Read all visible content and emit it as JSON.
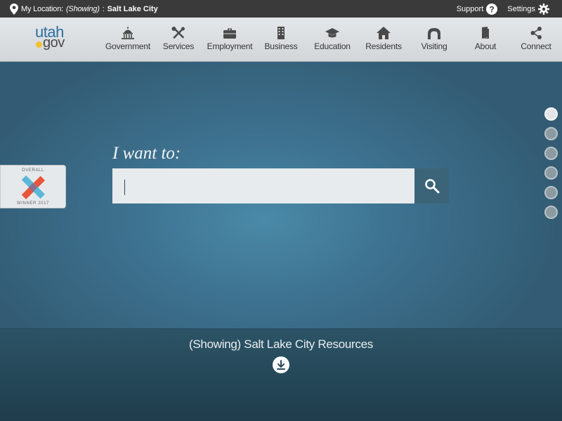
{
  "topbar": {
    "location_prefix": "My Location:",
    "location_showing": "(Showing)",
    "location_sep": ":",
    "location_city": "Salt Lake City",
    "support_label": "Support",
    "settings_label": "Settings"
  },
  "logo": {
    "part1": "utah",
    "part2": "gov"
  },
  "nav": {
    "items": [
      {
        "label": "Government",
        "icon": "capitol-icon"
      },
      {
        "label": "Services",
        "icon": "tools-icon"
      },
      {
        "label": "Employment",
        "icon": "briefcase-icon"
      },
      {
        "label": "Business",
        "icon": "building-icon"
      },
      {
        "label": "Education",
        "icon": "graduation-cap-icon"
      },
      {
        "label": "Residents",
        "icon": "home-icon"
      },
      {
        "label": "Visiting",
        "icon": "arch-icon"
      },
      {
        "label": "About",
        "icon": "book-icon"
      },
      {
        "label": "Connect",
        "icon": "share-icon"
      }
    ]
  },
  "hero": {
    "prompt": "I want to:",
    "search_value": ""
  },
  "badge": {
    "top": "OVERALL",
    "bottom": "WINNER 2017"
  },
  "slides": {
    "count": 6,
    "active": 0
  },
  "resources": {
    "title": "(Showing) Salt Lake City Resources"
  },
  "colors": {
    "topbar": "#3a3a3a",
    "hero": "#3d7290",
    "search_button": "#3b6478",
    "logo_blue": "#2b6f9e",
    "logo_dot": "#f2c12e"
  }
}
